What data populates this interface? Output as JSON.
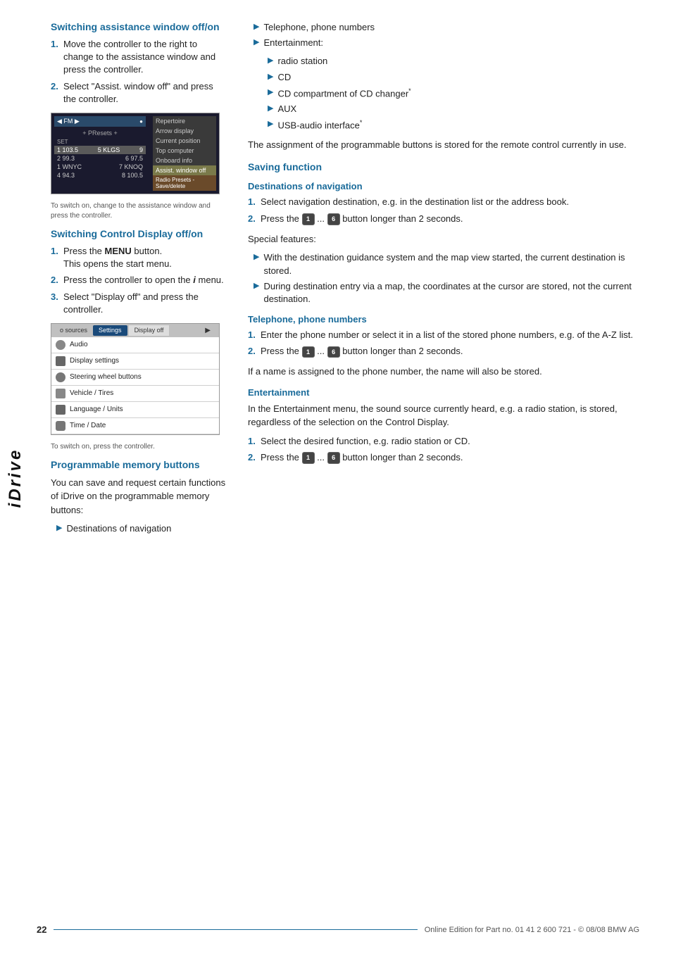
{
  "page": {
    "number": "22",
    "footer_text": "Online Edition for Part no. 01 41 2 600 721 - © 08/08 BMW AG",
    "sidebar_label": "iDrive"
  },
  "left_column": {
    "section1": {
      "heading": "Switching assistance window off/on",
      "steps": [
        "Move the controller to the right to change to the assistance window and press the controller.",
        "Select \"Assist. window off\" and press the controller."
      ],
      "screen_caption": "To switch on, change to the assistance window and press the controller."
    },
    "section2": {
      "heading": "Switching Control Display off/on",
      "steps": [
        {
          "text_before": "Press the ",
          "bold": "MENU",
          "text_after": " button.",
          "sub": "This opens the start menu."
        },
        {
          "text": "Press the controller to open the i menu."
        },
        {
          "text": "Select \"Display off\" and press the controller."
        }
      ],
      "screen_caption": "To switch on, press the controller."
    },
    "section3": {
      "heading": "Programmable memory buttons",
      "intro": "You can save and request certain functions of iDrive on the programmable memory buttons:",
      "bullets": [
        "Destinations of navigation"
      ]
    }
  },
  "right_column": {
    "bullets_continued": [
      "Telephone, phone numbers",
      "Entertainment:"
    ],
    "entertainment_sub": [
      "radio station",
      "CD",
      "CD compartment of CD changer*",
      "AUX",
      "USB-audio interface*"
    ],
    "assignment_note": "The assignment of the programmable buttons is stored for the remote control currently in use.",
    "saving_function": {
      "heading": "Saving function",
      "destinations_heading": "Destinations of navigation",
      "destinations_steps": [
        "Select navigation destination, e.g. in the destination list or the address book.",
        {
          "text_before": "Press the ",
          "btn1": "1",
          "ellipsis": " ... ",
          "btn2": "6",
          "text_after": " button longer than 2 seconds."
        }
      ],
      "special_features_label": "Special features:",
      "special_features": [
        "With the destination guidance system and the map view started, the current destination is stored.",
        "During destination entry via a map, the coordinates at the cursor are stored, not the current destination."
      ]
    },
    "telephone": {
      "heading": "Telephone, phone numbers",
      "steps": [
        "Enter the phone number or select it in a list of the stored phone numbers, e.g. of the A-Z list.",
        {
          "text_before": "Press the ",
          "btn1": "1",
          "ellipsis": " ... ",
          "btn2": "6",
          "text_after": " button longer than 2 seconds."
        }
      ],
      "note": "If a name is assigned to the phone number, the name will also be stored."
    },
    "entertainment": {
      "heading": "Entertainment",
      "intro": "In the Entertainment menu, the sound source currently heard, e.g. a radio station, is stored, regardless of the selection on the Control Display.",
      "steps": [
        "Select the desired function, e.g. radio station or CD.",
        {
          "text_before": "Press the ",
          "btn1": "1",
          "ellipsis": " ... ",
          "btn2": "6",
          "text_after": " button longer than 2 seconds."
        }
      ]
    }
  },
  "radio_screen": {
    "top_left": "FM",
    "presets_label": "+ PResets +",
    "set_label": "SET",
    "stations": [
      {
        "freq1": "103.5",
        "freq2": "5 KLGS",
        "num": "9"
      },
      {
        "freq1": "2 99.3",
        "freq2": "6 97.5"
      },
      {
        "freq1": "1 WNYC",
        "freq2": "7 KNOQ"
      },
      {
        "freq1": "4 94.3",
        "freq2": "8 100.5"
      }
    ],
    "menu_items": [
      "Repertoire",
      "Arrow display",
      "Current position",
      "Top computer",
      "Onboard info",
      "Assist. window off",
      "Radio Presets - Save/delete"
    ]
  },
  "settings_screen": {
    "tabs": [
      "o sources",
      "Settings",
      "Display off",
      "▶"
    ],
    "menu_items": [
      {
        "icon": "audio",
        "label": "Audio"
      },
      {
        "icon": "display",
        "label": "Display settings"
      },
      {
        "icon": "steering",
        "label": "Steering wheel buttons"
      },
      {
        "icon": "vehicle",
        "label": "Vehicle / Tires"
      },
      {
        "icon": "language",
        "label": "Language / Units"
      },
      {
        "icon": "time",
        "label": "Time / Date"
      }
    ]
  }
}
